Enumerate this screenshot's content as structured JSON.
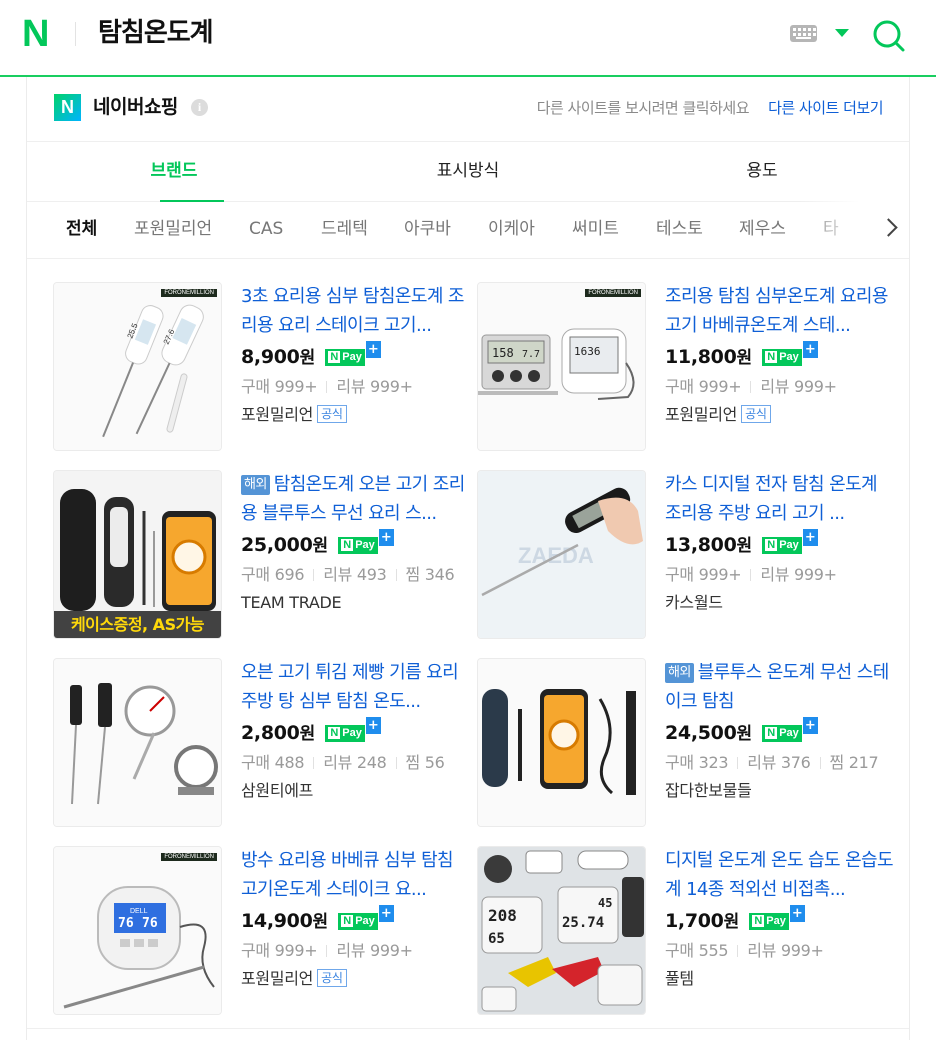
{
  "header": {
    "logo": "N",
    "query": "탐침온도계"
  },
  "section": {
    "badge": "N",
    "title": "네이버쇼핑",
    "info": "i",
    "description": "다른 사이트를 보시려면 클릭하세요",
    "more_link": "다른 사이트 더보기"
  },
  "tabs": [
    {
      "label": "브랜드",
      "active": true
    },
    {
      "label": "표시방식",
      "active": false
    },
    {
      "label": "용도",
      "active": false
    }
  ],
  "filters": [
    "전체",
    "포원밀리언",
    "CAS",
    "드레텍",
    "아쿠바",
    "이케아",
    "써미트",
    "테스토",
    "제우스",
    "타"
  ],
  "products": [
    {
      "title": "3초 요리용 심부 탐침온도계 조리용 요리 스테이크 고기...",
      "overseas": "",
      "price": "8,900",
      "won": "원",
      "npay": "Pay",
      "purchases": "구매 999+",
      "reviews": "리뷰 999+",
      "wishes": "",
      "seller": "포원밀리언",
      "official": "공식",
      "brand_tag": "FORONEMILLION",
      "promo": ""
    },
    {
      "title": "조리용 탐침 심부온도계 요리용 고기 바베큐온도계 스테...",
      "overseas": "",
      "price": "11,800",
      "won": "원",
      "npay": "Pay",
      "purchases": "구매 999+",
      "reviews": "리뷰 999+",
      "wishes": "",
      "seller": "포원밀리언",
      "official": "공식",
      "brand_tag": "FORONEMILLION",
      "promo": ""
    },
    {
      "title": "탐침온도계 오븐 고기 조리용 블루투스 무선 요리 스...",
      "overseas": "해외",
      "price": "25,000",
      "won": "원",
      "npay": "Pay",
      "purchases": "구매 696",
      "reviews": "리뷰 493",
      "wishes": "찜 346",
      "seller": "TEAM TRADE",
      "official": "",
      "brand_tag": "",
      "promo": "케이스증정, AS가능"
    },
    {
      "title": "카스 디지털 전자 탐침 온도계 조리용 주방 요리 고기 ...",
      "overseas": "",
      "price": "13,800",
      "won": "원",
      "npay": "Pay",
      "purchases": "구매 999+",
      "reviews": "리뷰 999+",
      "wishes": "",
      "seller": "카스월드",
      "official": "",
      "brand_tag": "",
      "promo": ""
    },
    {
      "title": "오븐 고기 튀김 제빵 기름 요리 주방 탕 심부 탐침 온도...",
      "overseas": "",
      "price": "2,800",
      "won": "원",
      "npay": "Pay",
      "purchases": "구매 488",
      "reviews": "리뷰 248",
      "wishes": "찜 56",
      "seller": "삼원티에프",
      "official": "",
      "brand_tag": "",
      "promo": ""
    },
    {
      "title": "블루투스 온도계 무선 스테이크 탐침",
      "overseas": "해외",
      "price": "24,500",
      "won": "원",
      "npay": "Pay",
      "purchases": "구매 323",
      "reviews": "리뷰 376",
      "wishes": "찜 217",
      "seller": "잡다한보물들",
      "official": "",
      "brand_tag": "",
      "promo": ""
    },
    {
      "title": "방수 요리용 바베큐 심부 탐침 고기온도계 스테이크 요...",
      "overseas": "",
      "price": "14,900",
      "won": "원",
      "npay": "Pay",
      "purchases": "구매 999+",
      "reviews": "리뷰 999+",
      "wishes": "",
      "seller": "포원밀리언",
      "official": "공식",
      "brand_tag": "FORONEMILLION",
      "promo": ""
    },
    {
      "title": "디지털 온도계 온도 습도 온습도계 14종 적외선 비접촉...",
      "overseas": "",
      "price": "1,700",
      "won": "원",
      "npay": "Pay",
      "purchases": "구매 555",
      "reviews": "리뷰 999+",
      "wishes": "",
      "seller": "풀템",
      "official": "",
      "brand_tag": "",
      "promo": ""
    }
  ],
  "images": {
    "p1_lcd": [
      "25.5",
      "27.6"
    ],
    "p2_lcd": [
      "158",
      "7.7",
      "1636"
    ],
    "p4_watermark": "ZAEDA",
    "p7_lcd": [
      "76",
      "76"
    ],
    "p7_brand": "DELL",
    "p8_lcd": [
      "208",
      "65",
      "25.74",
      "45"
    ]
  },
  "colors": {
    "naver_green": "#03c75a",
    "link_blue": "#0f5fd6",
    "promo_yellow": "#ffd90a"
  }
}
